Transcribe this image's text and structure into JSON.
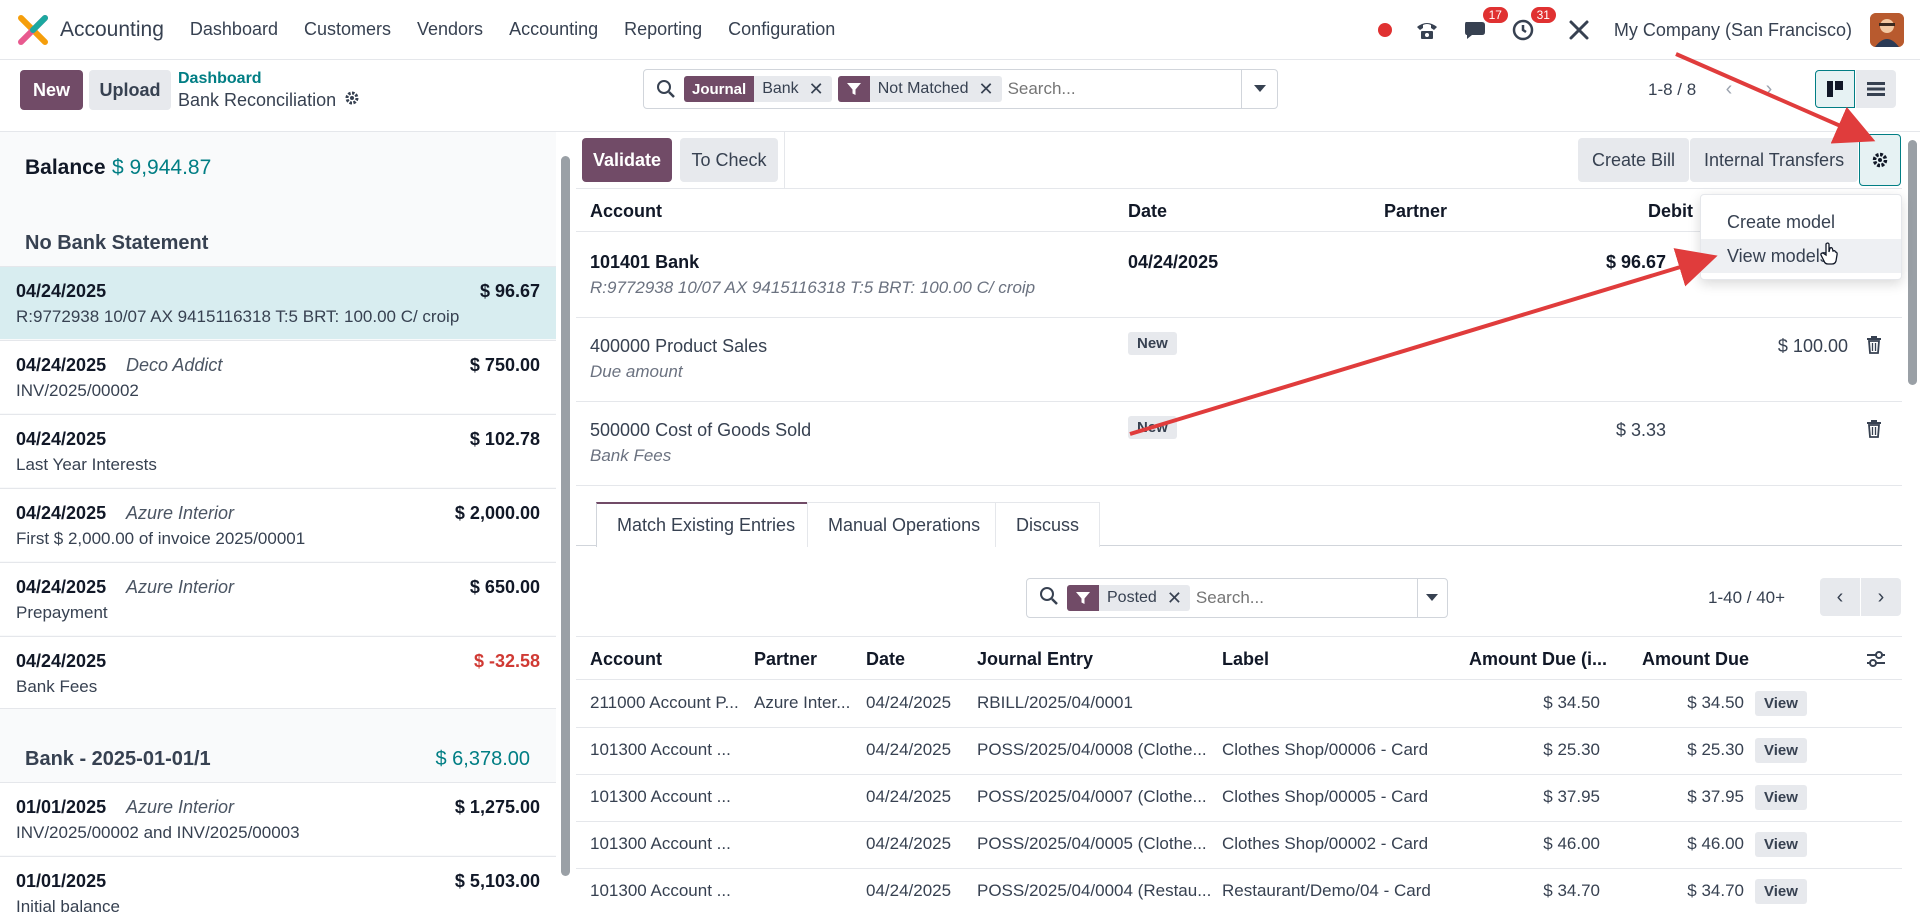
{
  "navbar": {
    "app_name": "Accounting",
    "menu": [
      "Dashboard",
      "Customers",
      "Vendors",
      "Accounting",
      "Reporting",
      "Configuration"
    ],
    "chat_badge": "17",
    "activity_badge": "31",
    "company": "My Company (San Francisco)"
  },
  "control_panel": {
    "new_label": "New",
    "upload_label": "Upload",
    "breadcrumb_parent": "Dashboard",
    "breadcrumb_current": "Bank Reconciliation",
    "search": {
      "facet1_label": "Journal",
      "facet1_value": "Bank",
      "facet2_value": "Not Matched",
      "placeholder": "Search..."
    },
    "pager": "1-8 / 8"
  },
  "left_panel": {
    "balance_label": "Balance",
    "balance_value": "$ 9,944.87",
    "group1_title": "No Bank Statement",
    "group1_items": [
      {
        "date": "04/24/2025",
        "partner": "",
        "amount": "$ 96.67",
        "label": "R:9772938 10/07 AX 9415116318 T:5 BRT: 100.00 C/ croip"
      },
      {
        "date": "04/24/2025",
        "partner": "Deco Addict",
        "amount": "$ 750.00",
        "label": "INV/2025/00002"
      },
      {
        "date": "04/24/2025",
        "partner": "",
        "amount": "$ 102.78",
        "label": "Last Year Interests"
      },
      {
        "date": "04/24/2025",
        "partner": "Azure Interior",
        "amount": "$ 2,000.00",
        "label": "First $ 2,000.00 of invoice 2025/00001"
      },
      {
        "date": "04/24/2025",
        "partner": "Azure Interior",
        "amount": "$ 650.00",
        "label": "Prepayment"
      },
      {
        "date": "04/24/2025",
        "partner": "",
        "amount": "$ -32.58",
        "label": "Bank Fees"
      }
    ],
    "group2_title": "Bank - 2025-01-01/1",
    "group2_amount": "$ 6,378.00",
    "group2_items": [
      {
        "date": "01/01/2025",
        "partner": "Azure Interior",
        "amount": "$ 1,275.00",
        "label": "INV/2025/00002 and INV/2025/00003"
      },
      {
        "date": "01/01/2025",
        "partner": "",
        "amount": "$ 5,103.00",
        "label": "Initial balance"
      }
    ]
  },
  "right_panel": {
    "validate_label": "Validate",
    "tocheck_label": "To Check",
    "createbill_label": "Create Bill",
    "transfers_label": "Internal Transfers",
    "lines_headers": {
      "account": "Account",
      "date": "Date",
      "partner": "Partner",
      "debit": "Debit"
    },
    "lines": [
      {
        "account": "101401 Bank",
        "sub": "R:9772938 10/07 AX 9415116318 T:5 BRT: 100.00 C/ croip",
        "date": "04/24/2025",
        "badge": "",
        "debit": "$ 96.67",
        "credit": ""
      },
      {
        "account": "400000 Product Sales",
        "sub": "Due amount",
        "date": "",
        "badge": "New",
        "debit": "",
        "credit": "$ 100.00"
      },
      {
        "account": "500000 Cost of Goods Sold",
        "sub": "Bank Fees",
        "date": "",
        "badge": "New",
        "debit": "$ 3.33",
        "credit": ""
      }
    ],
    "tabs": [
      "Match Existing Entries",
      "Manual Operations",
      "Discuss"
    ],
    "match_search": {
      "facet_value": "Posted",
      "placeholder": "Search..."
    },
    "match_pager": "1-40 / 40+",
    "match_headers": {
      "account": "Account",
      "partner": "Partner",
      "date": "Date",
      "entry": "Journal Entry",
      "label": "Label",
      "amount_due_currency": "Amount Due (i...",
      "amount_due": "Amount Due"
    },
    "view_label": "View",
    "match_rows": [
      {
        "account": "211000 Account P...",
        "partner": "Azure Inter...",
        "date": "04/24/2025",
        "entry": "RBILL/2025/04/0001",
        "label": "",
        "amount_cur": "$ 34.50",
        "amount": "$ 34.50"
      },
      {
        "account": "101300 Account ...",
        "partner": "",
        "date": "04/24/2025",
        "entry": "POSS/2025/04/0008 (Clothe...",
        "label": "Clothes Shop/00006 - Card",
        "amount_cur": "$ 25.30",
        "amount": "$ 25.30"
      },
      {
        "account": "101300 Account ...",
        "partner": "",
        "date": "04/24/2025",
        "entry": "POSS/2025/04/0007 (Clothe...",
        "label": "Clothes Shop/00005 - Card",
        "amount_cur": "$ 37.95",
        "amount": "$ 37.95"
      },
      {
        "account": "101300 Account ...",
        "partner": "",
        "date": "04/24/2025",
        "entry": "POSS/2025/04/0005 (Clothe...",
        "label": "Clothes Shop/00002 - Card",
        "amount_cur": "$ 46.00",
        "amount": "$ 46.00"
      },
      {
        "account": "101300 Account ...",
        "partner": "",
        "date": "04/24/2025",
        "entry": "POSS/2025/04/0004 (Restau...",
        "label": "Restaurant/Demo/04 - Card",
        "amount_cur": "$ 34.70",
        "amount": "$ 34.70"
      }
    ]
  },
  "dropdown": {
    "items": [
      "Create model",
      "View models"
    ]
  },
  "colors": {
    "primary": "#714b67",
    "teal": "#017e84",
    "negative": "#d03a34",
    "annotation": "#e03c3c"
  }
}
